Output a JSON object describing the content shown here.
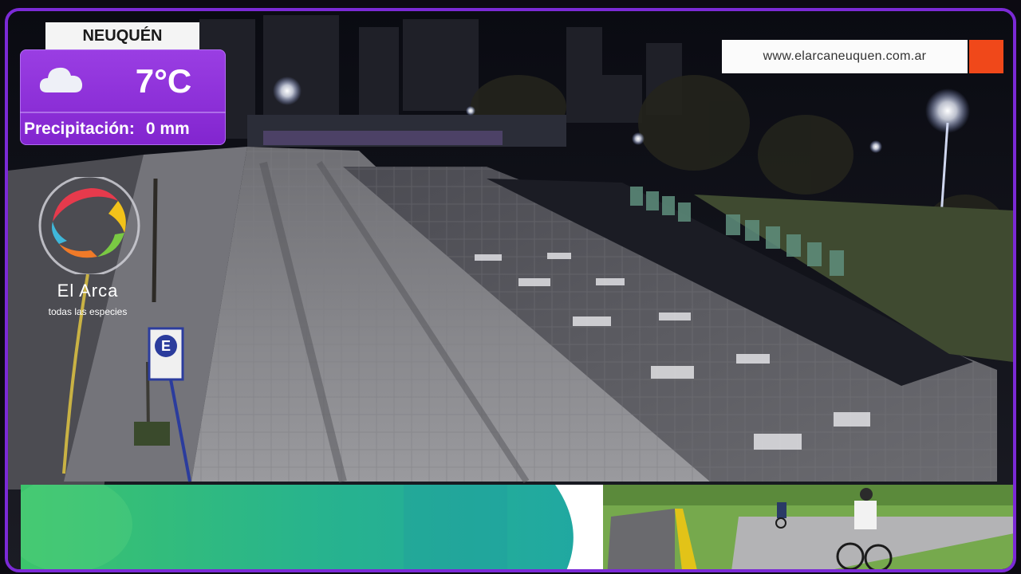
{
  "weather": {
    "city": "NEUQUÉN",
    "icon": "cloud-icon",
    "temperature": "7°C",
    "precipitation_label": "Precipitación:",
    "precipitation_value": "0 mm"
  },
  "banner": {
    "url": "www.elarcaneuquen.com.ar"
  },
  "logo": {
    "name": "El Arca",
    "tagline": "todas las especies"
  },
  "scene": {
    "sign_letter": "E"
  },
  "colors": {
    "frame": "#7b2ad6",
    "widget_purple": "#8a2bd6",
    "url_accent": "#f0481a",
    "banner_green": "#2fc17e",
    "banner_teal": "#22a8a0"
  }
}
